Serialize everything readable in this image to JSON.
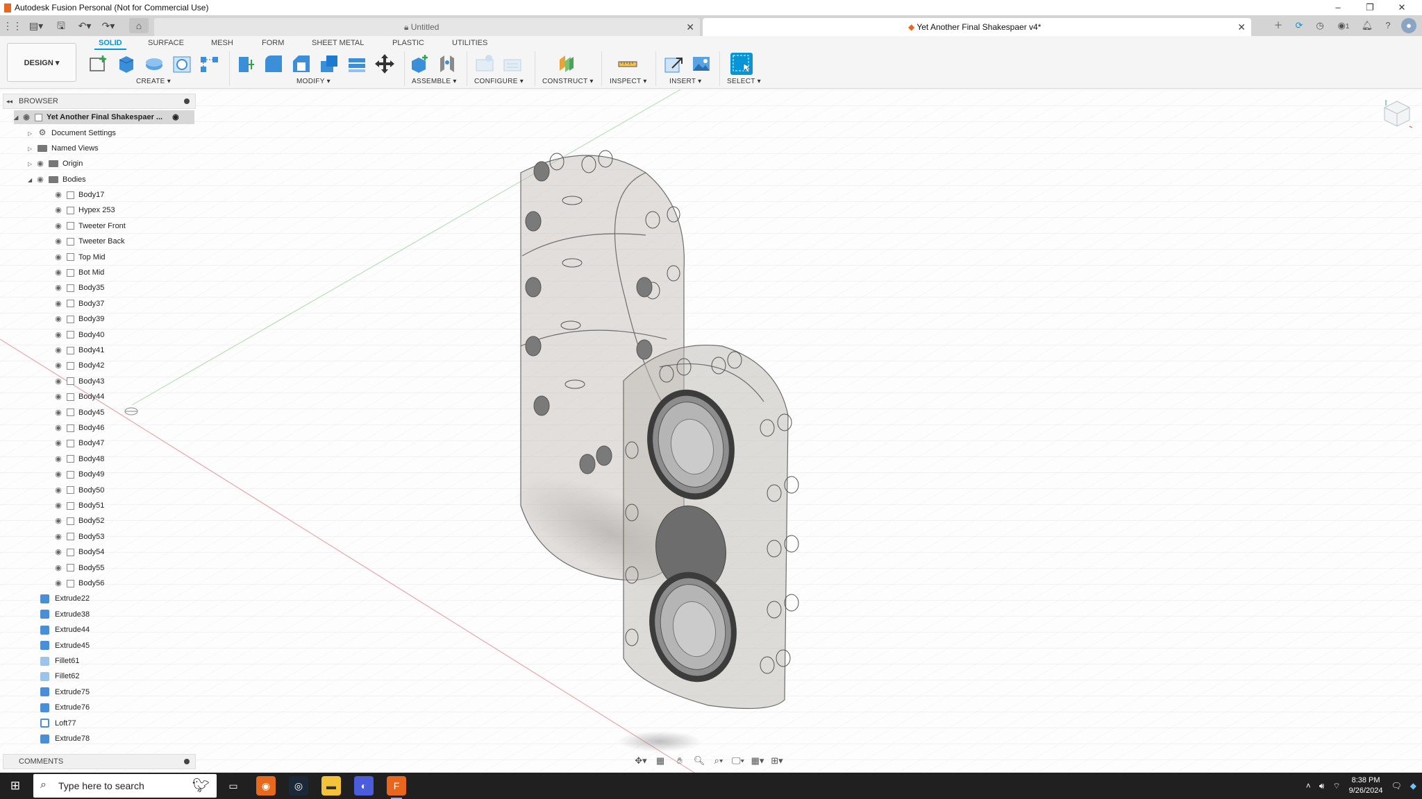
{
  "window": {
    "title": "Autodesk Fusion Personal (Not for Commercial Use)",
    "controls": [
      "–",
      "❐",
      "✕"
    ]
  },
  "tabs": [
    {
      "label": "Untitled",
      "locked": true,
      "active": false
    },
    {
      "label": "Yet Another Final Shakespaer v4*",
      "locked": false,
      "active": true
    }
  ],
  "tab_bar_icons": [
    "plus-icon",
    "sync-icon",
    "clock-icon",
    "job-status-icon",
    "bell-icon",
    "help-icon",
    "user-avatar"
  ],
  "job_count": "1",
  "workspace": {
    "label": "DESIGN ▾"
  },
  "ribbon_tabs": [
    {
      "label": "SOLID",
      "active": true
    },
    {
      "label": "SURFACE",
      "active": false
    },
    {
      "label": "MESH",
      "active": false
    },
    {
      "label": "FORM",
      "active": false
    },
    {
      "label": "SHEET METAL",
      "active": false
    },
    {
      "label": "PLASTIC",
      "active": false
    },
    {
      "label": "UTILITIES",
      "active": false
    }
  ],
  "ribbon_groups": [
    {
      "label": "CREATE ▾"
    },
    {
      "label": "MODIFY ▾"
    },
    {
      "label": "ASSEMBLE ▾"
    },
    {
      "label": "CONFIGURE ▾"
    },
    {
      "label": "CONSTRUCT ▾"
    },
    {
      "label": "INSPECT ▾"
    },
    {
      "label": "INSERT ▾"
    },
    {
      "label": "SELECT ▾"
    }
  ],
  "browser": {
    "title": "BROWSER",
    "root": "Yet Another Final Shakespaer ...",
    "folders": [
      "Document Settings",
      "Named Views",
      "Origin",
      "Bodies"
    ],
    "bodies": [
      "Body17",
      "Hypex 253",
      "Tweeter Front",
      "Tweeter Back",
      "Top Mid",
      "Bot Mid",
      "Body35",
      "Body37",
      "Body39",
      "Body40",
      "Body41",
      "Body42",
      "Body43",
      "Body44",
      "Body45",
      "Body46",
      "Body47",
      "Body48",
      "Body49",
      "Body50",
      "Body51",
      "Body52",
      "Body53",
      "Body54",
      "Body55",
      "Body56"
    ],
    "features": [
      {
        "label": "Extrude22",
        "kind": "extrude"
      },
      {
        "label": "Extrude38",
        "kind": "extrude"
      },
      {
        "label": "Extrude44",
        "kind": "extrude"
      },
      {
        "label": "Extrude45",
        "kind": "extrude"
      },
      {
        "label": "Fillet61",
        "kind": "fillet"
      },
      {
        "label": "Fillet62",
        "kind": "fillet"
      },
      {
        "label": "Extrude75",
        "kind": "extrude"
      },
      {
        "label": "Extrude76",
        "kind": "extrude"
      },
      {
        "label": "Loft77",
        "kind": "loft"
      },
      {
        "label": "Extrude78",
        "kind": "extrude"
      }
    ]
  },
  "comments": {
    "title": "COMMENTS"
  },
  "taskbar": {
    "search_placeholder": "Type here to search",
    "time": "8:38 PM",
    "date": "9/26/2024"
  }
}
